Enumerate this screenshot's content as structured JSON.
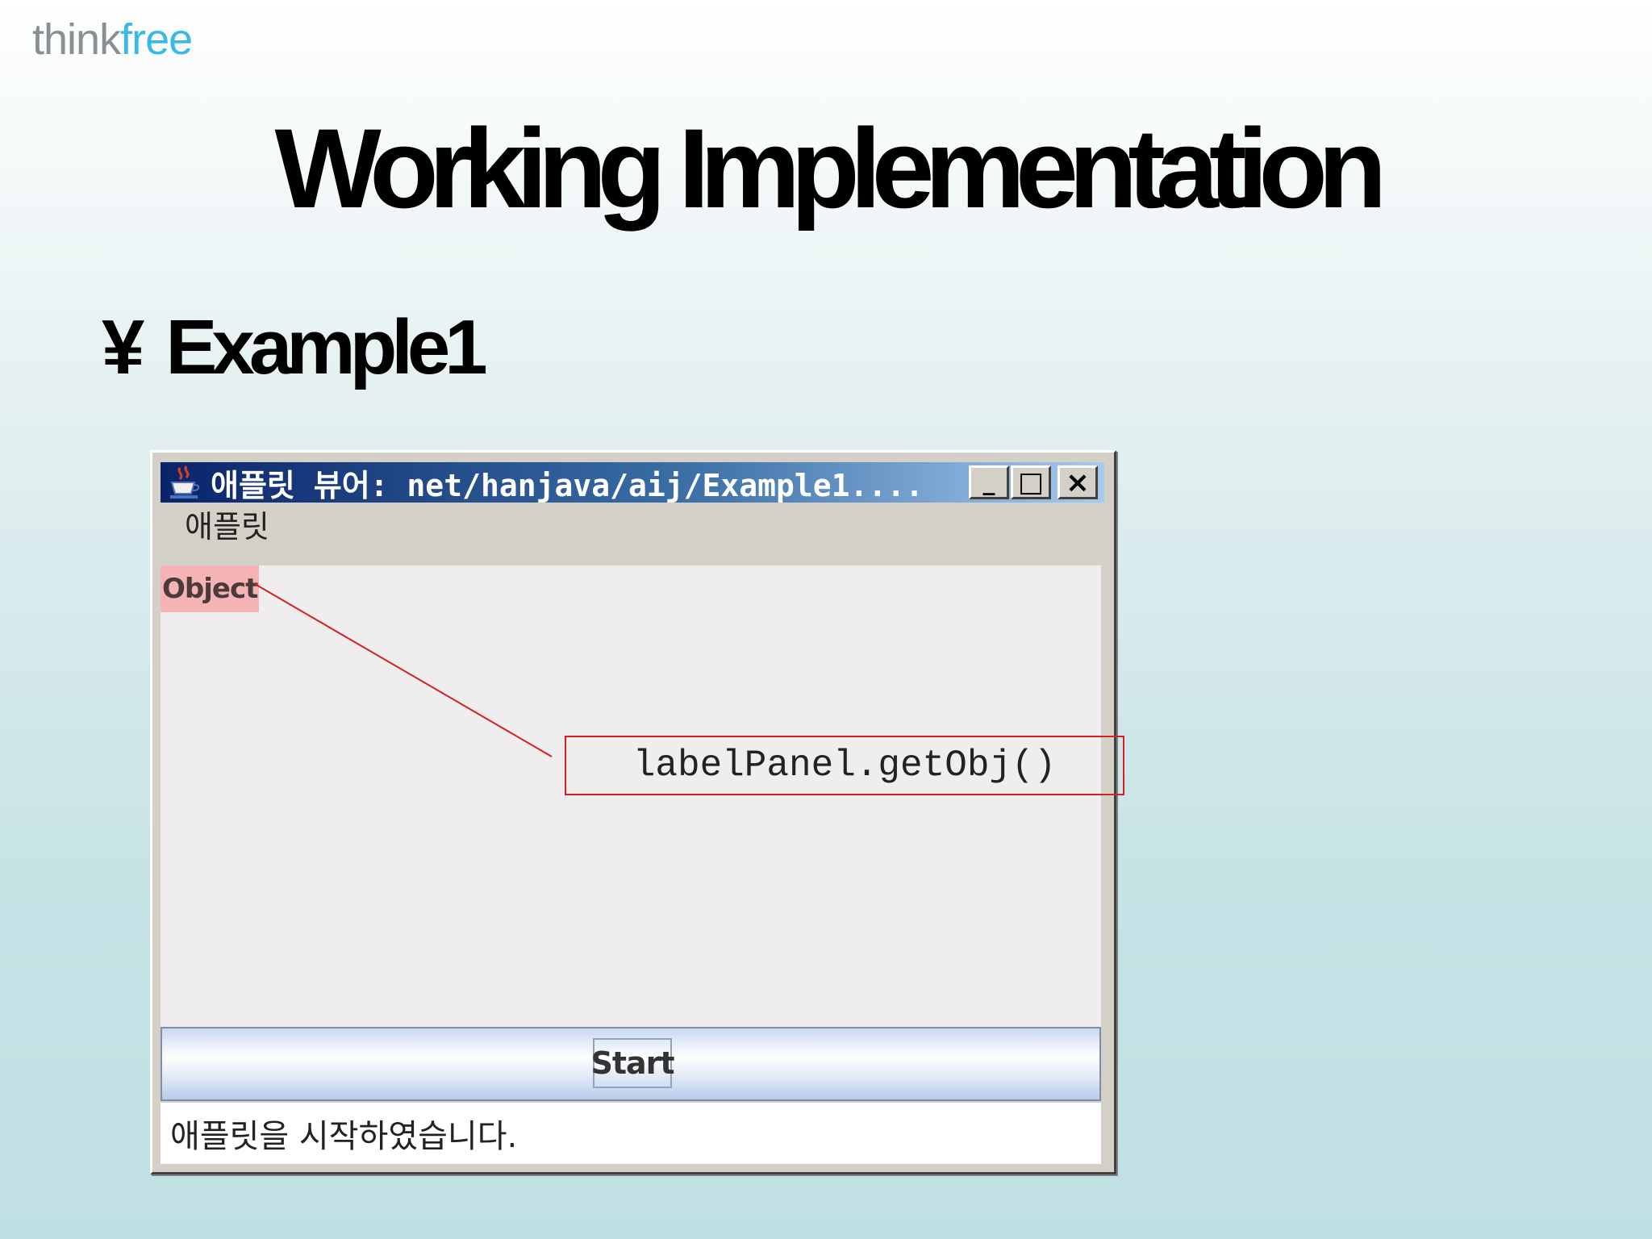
{
  "logo": {
    "part1": "think",
    "part2": "free"
  },
  "slide": {
    "title": "Working Implementation",
    "bullet_mark": "¥",
    "bullet_text": "Example1"
  },
  "window": {
    "title": "애플릿 뷰어: net/hanjava/aij/Example1....",
    "menu": [
      "애플릿"
    ],
    "controls": {
      "minimize": "_",
      "maximize": "□",
      "close": "×"
    },
    "object_label": "Object",
    "start_label": "Start",
    "status": "애플릿을 시작하였습니다."
  },
  "annotation": {
    "callout_text": "labelPanel.getObj()",
    "color": "#d42020"
  },
  "colors": {
    "titlebar_dark": "#0a246a",
    "titlebar_light": "#a6caf0",
    "object_bg": "#f6b3b6"
  }
}
